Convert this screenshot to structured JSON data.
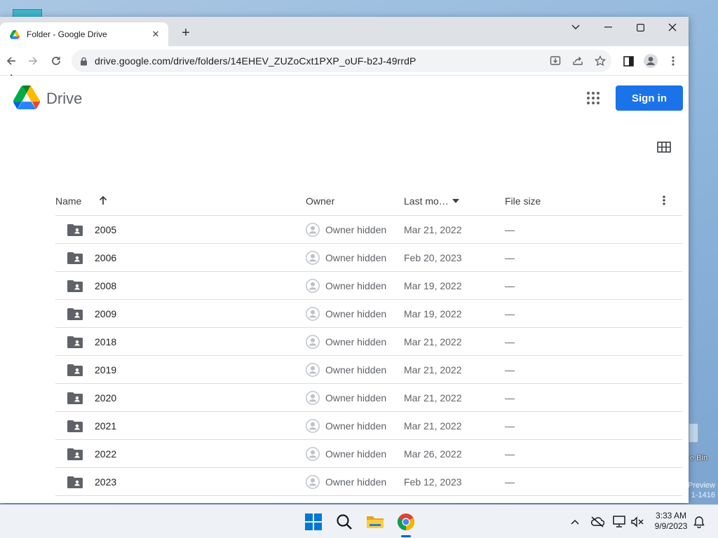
{
  "browser": {
    "tab_title": "Folder - Google Drive",
    "url": "drive.google.com/drive/folders/14EHEV_ZUZoCxt1PXP_oUF-b2J-49rrdP"
  },
  "drive": {
    "brand": "Drive",
    "sign_in_label": "Sign in",
    "columns": {
      "name": "Name",
      "owner": "Owner",
      "last_modified": "Last mo…",
      "file_size": "File size"
    },
    "rows": [
      {
        "name": "2005",
        "owner": "Owner hidden",
        "modified": "Mar 21, 2022",
        "size": "—"
      },
      {
        "name": "2006",
        "owner": "Owner hidden",
        "modified": "Feb 20, 2023",
        "size": "—"
      },
      {
        "name": "2008",
        "owner": "Owner hidden",
        "modified": "Mar 19, 2022",
        "size": "—"
      },
      {
        "name": "2009",
        "owner": "Owner hidden",
        "modified": "Mar 19, 2022",
        "size": "—"
      },
      {
        "name": "2018",
        "owner": "Owner hidden",
        "modified": "Mar 21, 2022",
        "size": "—"
      },
      {
        "name": "2019",
        "owner": "Owner hidden",
        "modified": "Mar 21, 2022",
        "size": "—"
      },
      {
        "name": "2020",
        "owner": "Owner hidden",
        "modified": "Mar 21, 2022",
        "size": "—"
      },
      {
        "name": "2021",
        "owner": "Owner hidden",
        "modified": "Mar 21, 2022",
        "size": "—"
      },
      {
        "name": "2022",
        "owner": "Owner hidden",
        "modified": "Mar 26, 2022",
        "size": "—"
      },
      {
        "name": "2023",
        "owner": "Owner hidden",
        "modified": "Feb 12, 2023",
        "size": "—"
      }
    ]
  },
  "desktop": {
    "recycle_bin_label": "e Bin",
    "watermark_line1": "Preview",
    "watermark_line2": "1-1416"
  },
  "taskbar": {
    "time": "3:33 AM",
    "date": "9/9/2023"
  },
  "colors": {
    "accent": "#1a73e8",
    "folder": "#5f6368",
    "tabstrip": "#dee1e6"
  }
}
